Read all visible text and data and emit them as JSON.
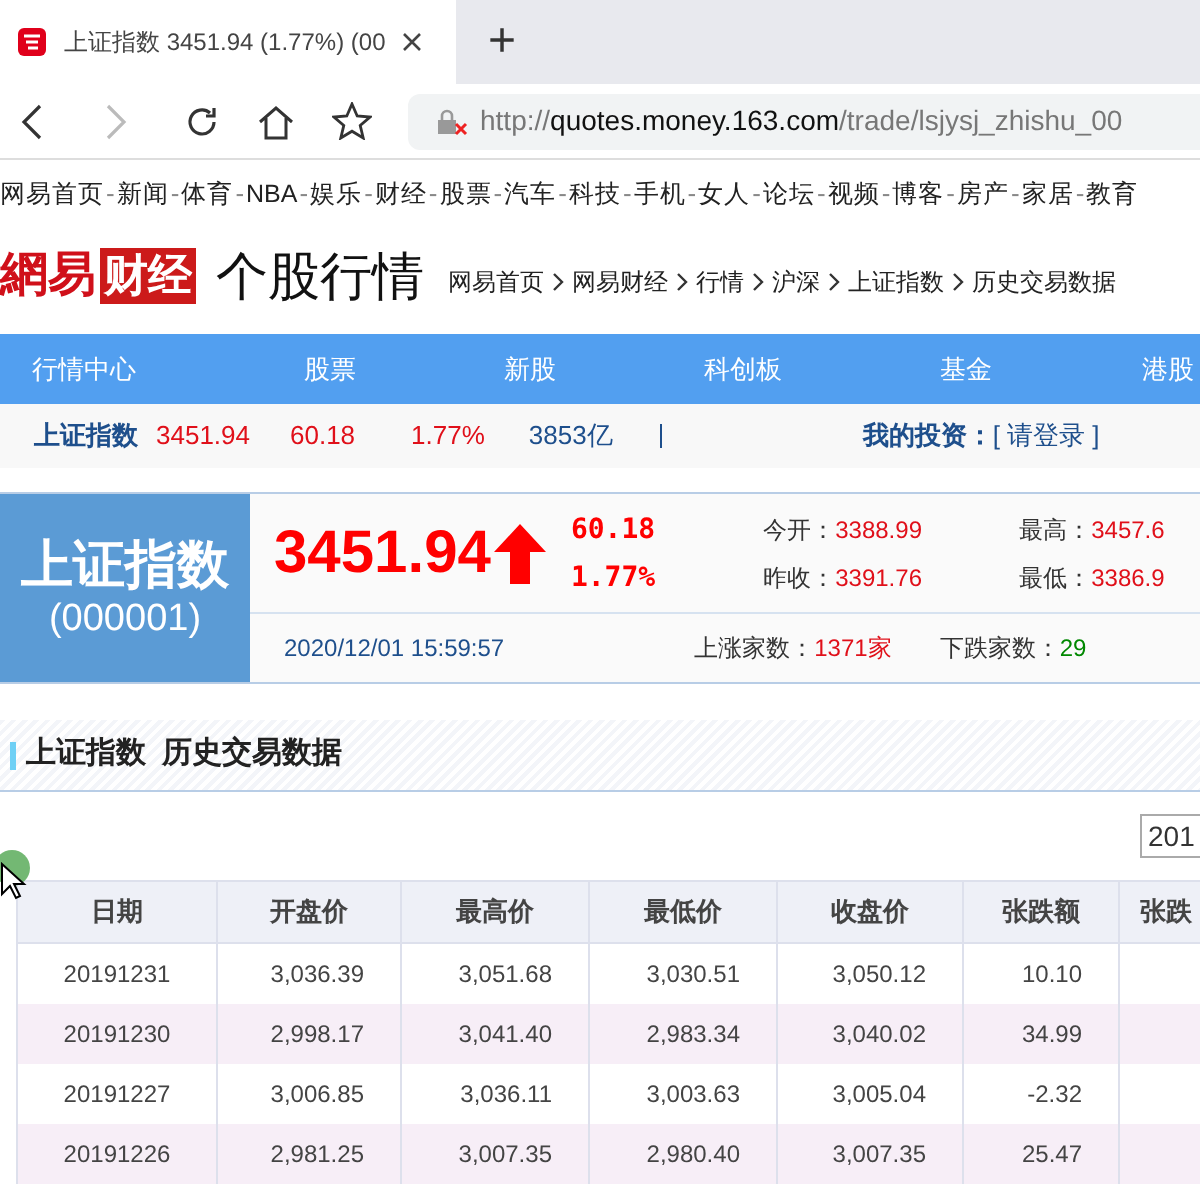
{
  "browser": {
    "tab_title": "上证指数 3451.94 (1.77%) (00",
    "new_tab": "+",
    "url_scheme": "http://",
    "url_host": "quotes.money.163.com",
    "url_path": "/trade/lsjysj_zhishu_00"
  },
  "site_nav": {
    "separator": "-",
    "links": [
      "网易首页",
      "新闻",
      "体育",
      "NBA",
      "娱乐",
      "财经",
      "股票",
      "汽车",
      "科技",
      "手机",
      "女人",
      "论坛",
      "视频",
      "博客",
      "房产",
      "家居",
      "教育"
    ]
  },
  "header": {
    "logo_a": "網易",
    "logo_b": "财经",
    "title": "个股行情",
    "breadcrumb": [
      "网易首页",
      "网易财经",
      "行情",
      "沪深",
      "上证指数",
      "历史交易数据"
    ]
  },
  "main_nav": [
    "行情中心",
    "股票",
    "新股",
    "科创板",
    "基金",
    "港股"
  ],
  "quote_strip": {
    "name": "上证指数",
    "price": "3451.94",
    "change": "60.18",
    "percent": "1.77%",
    "volume": "3853亿",
    "investment_label": "我的投资：",
    "login": "[ 请登录 ]"
  },
  "quote_panel": {
    "name": "上证指数",
    "code": "(000001)",
    "price": "3451.94",
    "change": "60.18",
    "percent": "1.77%",
    "stats": [
      {
        "label": "今开：",
        "value": "3388.99"
      },
      {
        "label": "最高：",
        "value": "3457.6"
      },
      {
        "label": "昨收：",
        "value": "3391.76"
      },
      {
        "label": "最低：",
        "value": "3386.9"
      }
    ],
    "time": "2020/12/01 15:59:57",
    "advancers_label": "上涨家数：",
    "advancers_value": "1371",
    "advancers_unit": "家",
    "decliners_label": "下跌家数：",
    "decliners_value": "29"
  },
  "section": {
    "title_a": "上证指数",
    "title_b": "历史交易数据",
    "year_select": "201"
  },
  "table": {
    "columns": [
      "日期",
      "开盘价",
      "最高价",
      "最低价",
      "收盘价",
      "张跌额",
      "张跌"
    ],
    "rows": [
      [
        "20191231",
        "3,036.39",
        "3,051.68",
        "3,030.51",
        "3,050.12",
        "10.10"
      ],
      [
        "20191230",
        "2,998.17",
        "3,041.40",
        "2,983.34",
        "3,040.02",
        "34.99"
      ],
      [
        "20191227",
        "3,006.85",
        "3,036.11",
        "3,003.63",
        "3,005.04",
        "-2.32"
      ],
      [
        "20191226",
        "2,981.25",
        "3,007.35",
        "2,980.40",
        "3,007.35",
        "25.47"
      ]
    ]
  }
}
